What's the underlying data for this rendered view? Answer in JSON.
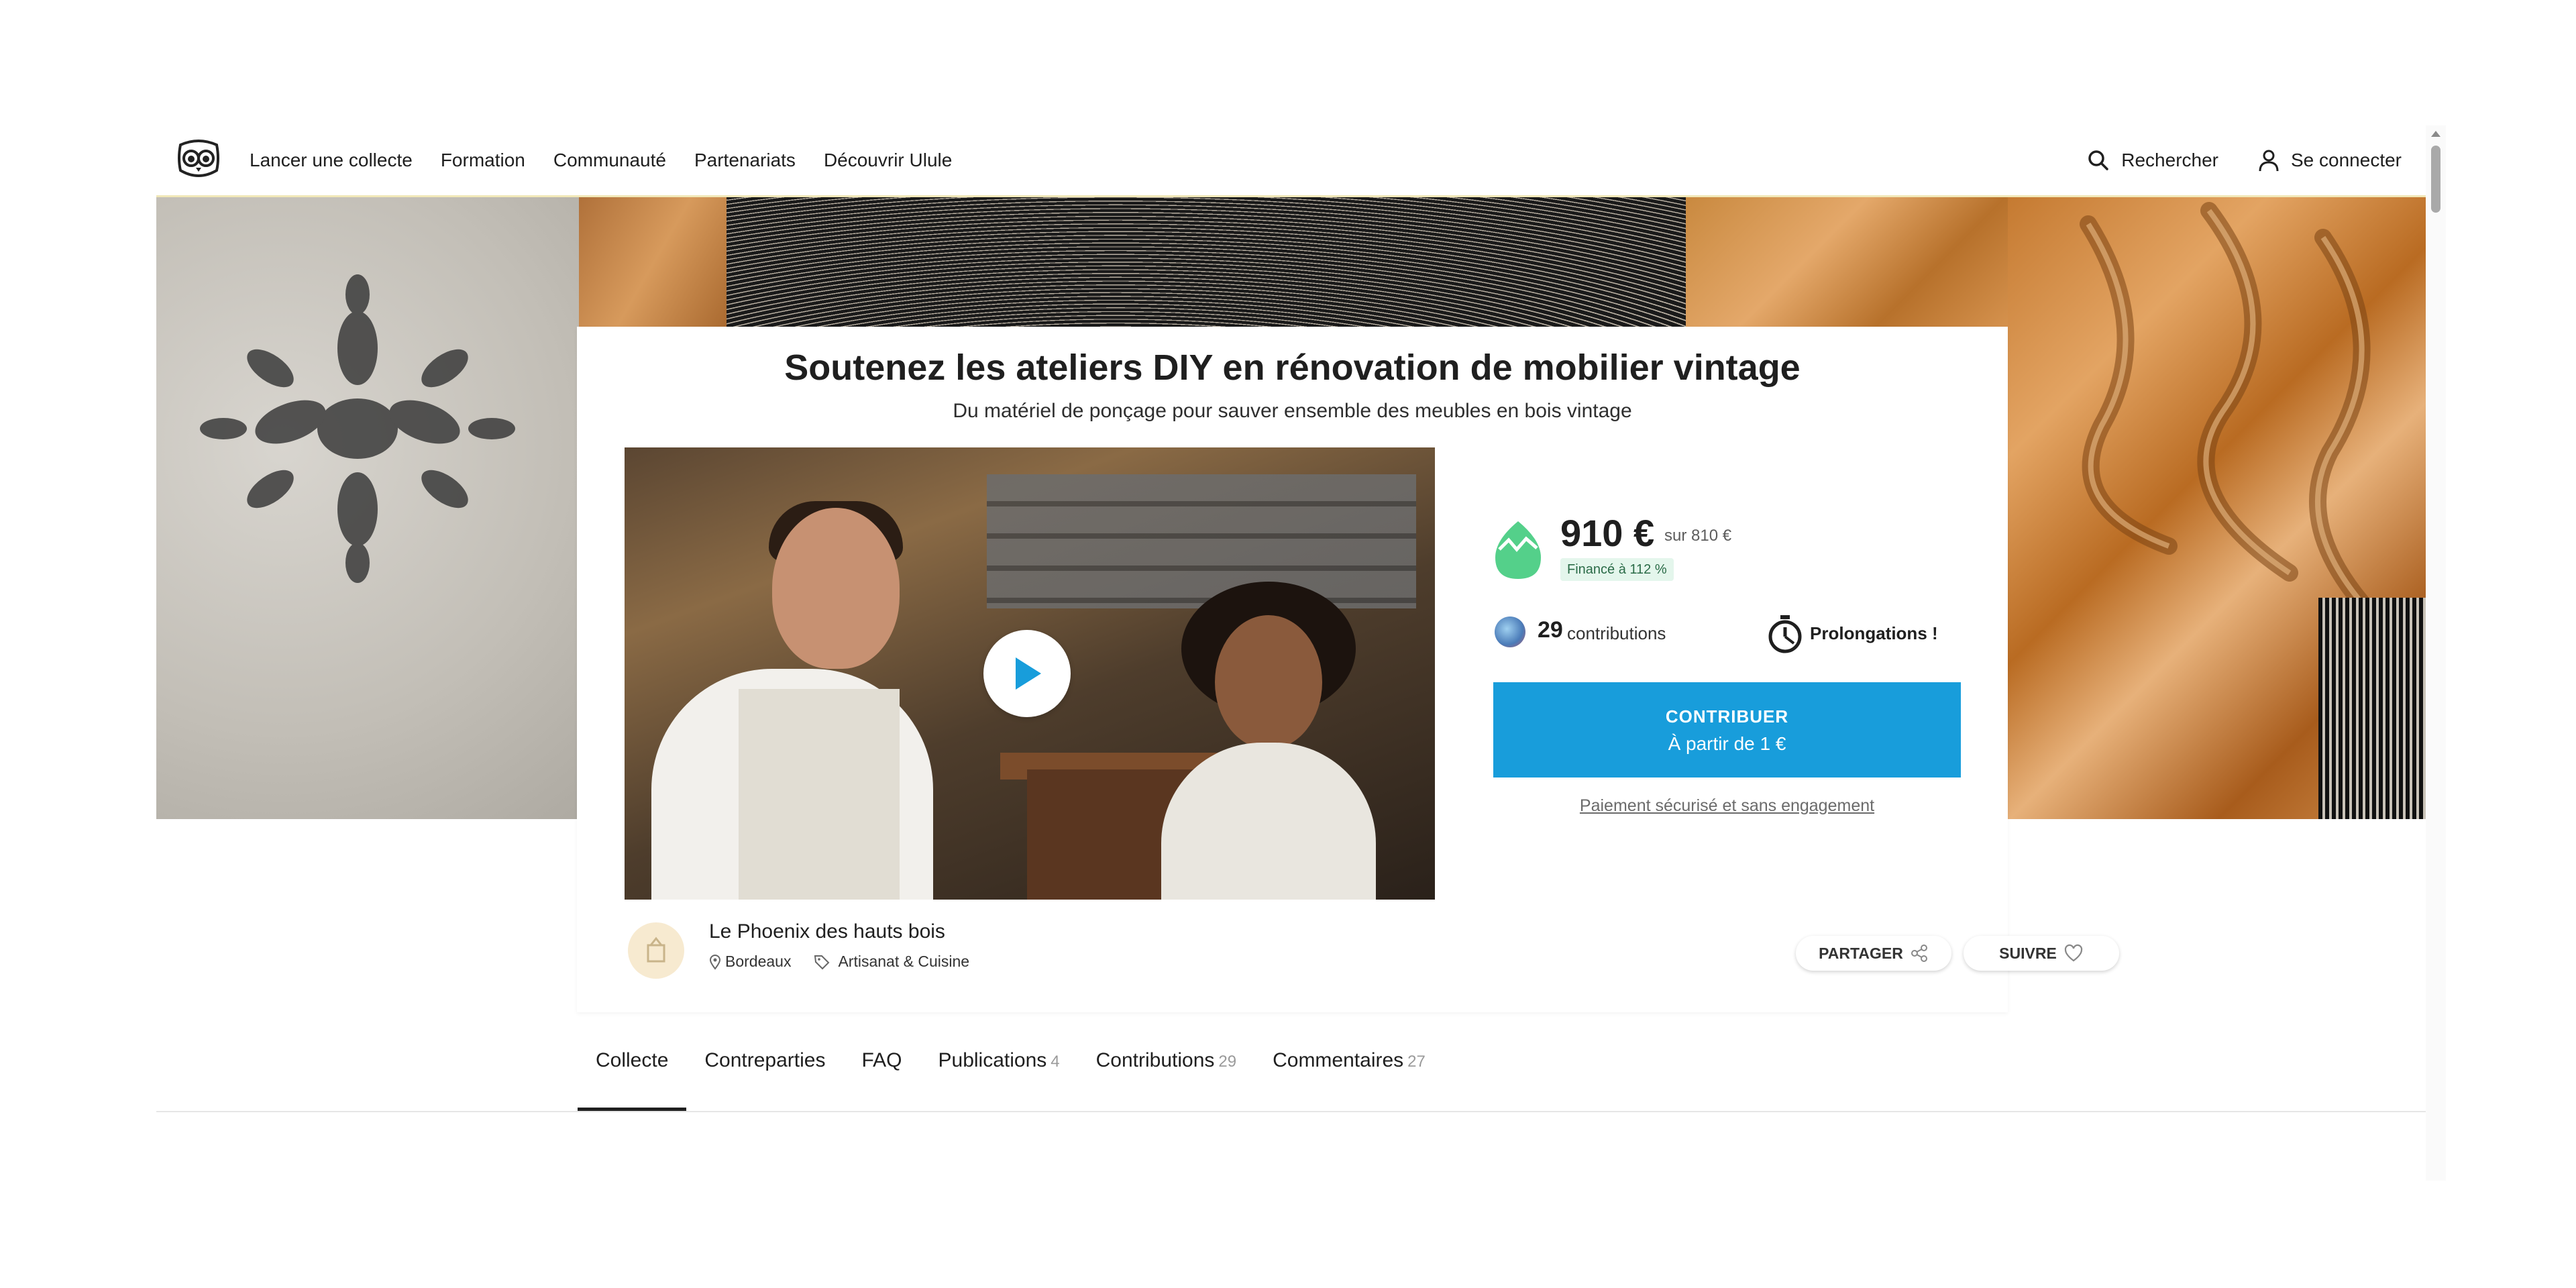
{
  "nav": {
    "links": [
      "Lancer une collecte",
      "Formation",
      "Communauté",
      "Partenariats",
      "Découvrir Ulule"
    ],
    "search_label": "Rechercher",
    "login_label": "Se connecter"
  },
  "project": {
    "title": "Soutenez les ateliers DIY en rénovation de mobilier vintage",
    "subtitle": "Du matériel de ponçage pour sauver ensemble des meubles en bois vintage",
    "raised": "910 €",
    "goal": "sur 810 €",
    "funded_badge": "Financé à 112 %",
    "funded_percent": 112,
    "contributions_count": "29",
    "contributions_label": "contributions",
    "extension_label": "Prolongations !",
    "cta_line1": "CONTRIBUER",
    "cta_line2": "À partir de 1 €",
    "secure_note": "Paiement sécurisé et sans engagement",
    "owner_name": "Le Phoenix des hauts bois",
    "location": "Bordeaux",
    "category": "Artisanat & Cuisine",
    "share_label": "PARTAGER",
    "follow_label": "SUIVRE"
  },
  "tabs": [
    {
      "label": "Collecte",
      "count": ""
    },
    {
      "label": "Contreparties",
      "count": ""
    },
    {
      "label": "FAQ",
      "count": ""
    },
    {
      "label": "Publications",
      "count": "4"
    },
    {
      "label": "Contributions",
      "count": "29"
    },
    {
      "label": "Commentaires",
      "count": "27"
    }
  ],
  "colors": {
    "accent": "#189ddb",
    "funded_green": "#54d08a",
    "text": "#1f1f1f"
  },
  "icons": [
    "ulule-owl-logo",
    "search-icon",
    "user-icon",
    "play-icon",
    "egg-icon",
    "stopwatch-icon",
    "location-pin-icon",
    "tag-icon",
    "share-icon",
    "heart-icon"
  ]
}
